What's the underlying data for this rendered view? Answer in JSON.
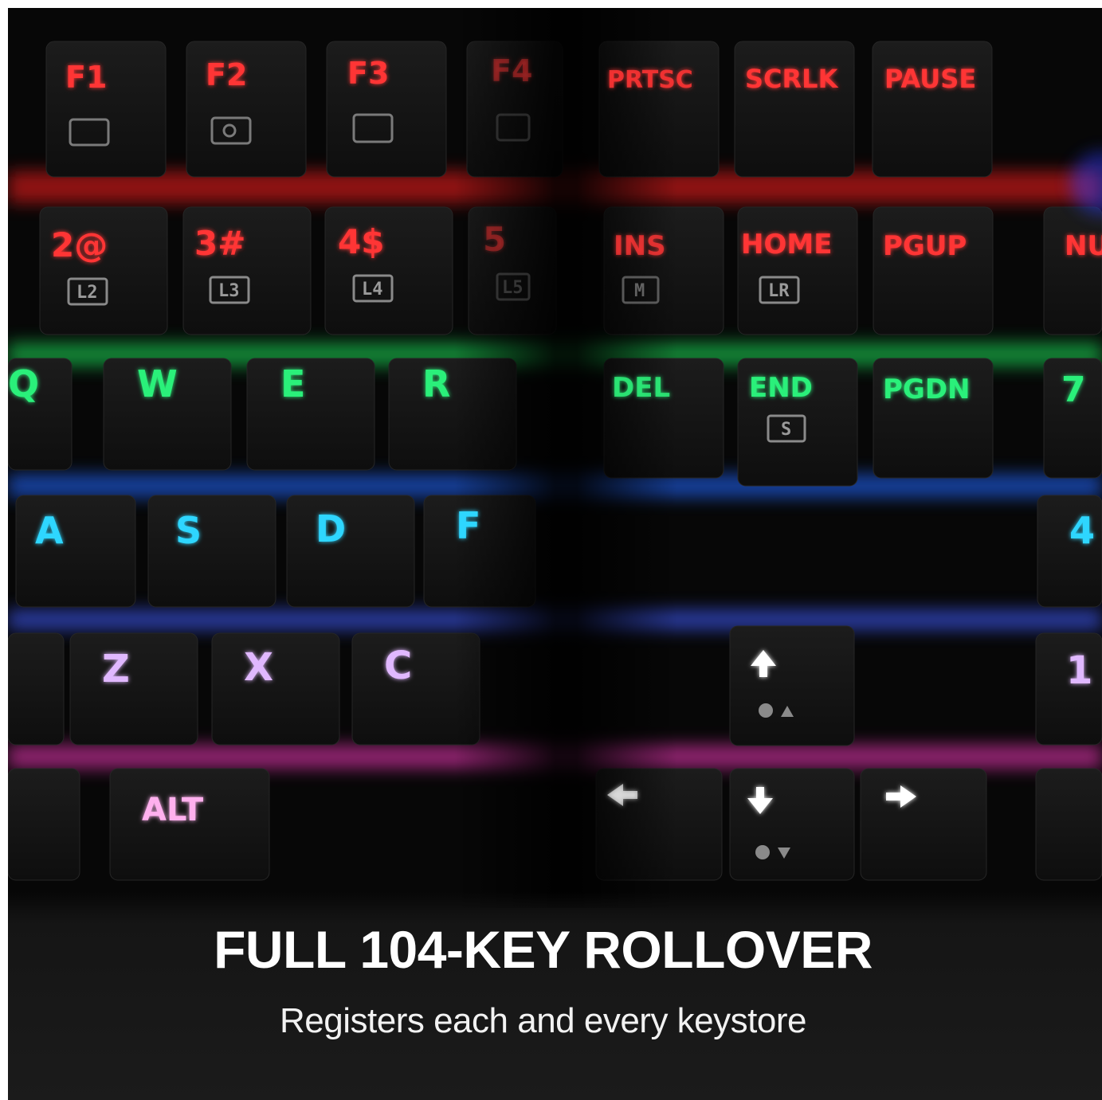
{
  "caption": {
    "headline": "FULL 104-KEY ROLLOVER",
    "subline": "Registers each and every keystore"
  },
  "keyboard": {
    "function_row": [
      "F1",
      "F2",
      "F3",
      "F4"
    ],
    "system_row": [
      "PRTSC",
      "SCRLK",
      "PAUSE"
    ],
    "number_row": [
      "2@",
      "3#",
      "4$",
      "5"
    ],
    "number_sublegends": [
      "L2",
      "L3",
      "L4",
      "L5"
    ],
    "nav_row_1": [
      "INS",
      "HOME",
      "PGUP",
      "NU"
    ],
    "nav_row_1_sublegends": [
      "M",
      "LR"
    ],
    "qwerty_row": [
      "Q",
      "W",
      "E",
      "R"
    ],
    "nav_row_2": [
      "DEL",
      "END",
      "PGDN",
      "7"
    ],
    "nav_row_2_sublegends": [
      "S"
    ],
    "home_row": [
      "A",
      "S",
      "D",
      "F"
    ],
    "numpad_mid": "4",
    "bottom_row": [
      "Z",
      "X",
      "C"
    ],
    "numpad_low": "1",
    "modifier": "ALT",
    "arrows": [
      "up-arrow",
      "left-arrow",
      "down-arrow",
      "right-arrow"
    ],
    "glow_colors": {
      "red": "#ff2a2a",
      "green": "#22ee66",
      "blue": "#2b6dff",
      "cyan": "#28d8ff",
      "violet": "#c45cff",
      "magenta": "#ff3fc8",
      "keycap": "#151515"
    }
  }
}
